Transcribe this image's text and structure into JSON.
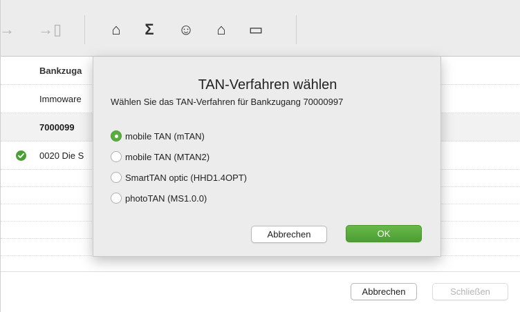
{
  "toolbar": {
    "icons": [
      "arrow-right-icon",
      "export-door-icon",
      "bank-roof-icon",
      "sigma-icon",
      "user-circle-icon",
      "bank-settings-icon",
      "inbox-tray-icon"
    ],
    "glyphs": [
      "→",
      "→▯",
      "⌂",
      "Σ",
      "☺",
      "⌂",
      "▭"
    ]
  },
  "table": {
    "header": "Bankzuga",
    "rows": [
      {
        "text": "Immoware",
        "bold": false,
        "check": false
      },
      {
        "text": "7000099",
        "bold": true,
        "check": false
      },
      {
        "text": "0020 Die S",
        "bold": false,
        "check": true
      }
    ]
  },
  "dialog": {
    "title": "TAN-Verfahren wählen",
    "subtitle": "Wählen Sie das TAN-Verfahren für Bankzugang 70000997",
    "options": [
      {
        "label": "mobile TAN (mTAN)",
        "selected": true
      },
      {
        "label": "mobile TAN (MTAN2)",
        "selected": false
      },
      {
        "label": "SmartTAN optic (HHD1.4OPT)",
        "selected": false
      },
      {
        "label": "photoTAN (MS1.0.0)",
        "selected": false
      }
    ],
    "cancel_label": "Abbrechen",
    "ok_label": "OK"
  },
  "footer": {
    "cancel_label": "Abbrechen",
    "close_label": "Schließen"
  },
  "colors": {
    "accent_green": "#5aad3f",
    "check_green": "#4aa035"
  }
}
